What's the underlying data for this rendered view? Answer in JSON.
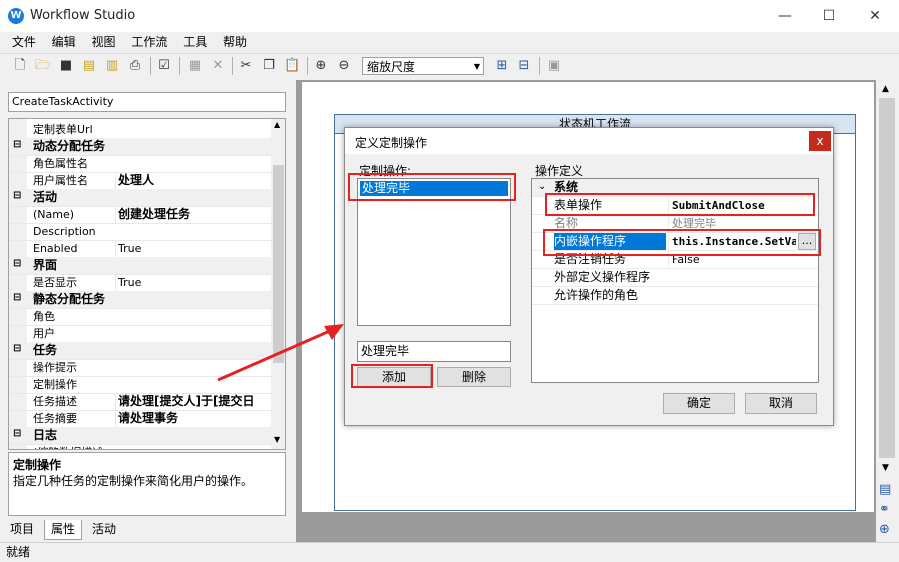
{
  "window": {
    "title": "Workflow Studio",
    "minimize": "—",
    "maximize": "☐",
    "close": "✕"
  },
  "menu": [
    "文件",
    "编辑",
    "视图",
    "工作流",
    "工具",
    "帮助"
  ],
  "toolbar": {
    "zoom_label": "缩放尺度"
  },
  "left_panel": {
    "activity": "CreateTaskActivity",
    "properties": [
      {
        "kind": "prop",
        "name": "定制表单Url",
        "value": ""
      },
      {
        "kind": "cat",
        "name": "动态分配任务"
      },
      {
        "kind": "prop",
        "name": "角色属性名",
        "value": ""
      },
      {
        "kind": "prop",
        "name": "用户属性名",
        "value": "处理人",
        "bold": true
      },
      {
        "kind": "cat",
        "name": "活动"
      },
      {
        "kind": "prop",
        "name": "(Name)",
        "value": "创建处理任务",
        "bold": true
      },
      {
        "kind": "prop",
        "name": "Description",
        "value": ""
      },
      {
        "kind": "prop",
        "name": "Enabled",
        "value": "True"
      },
      {
        "kind": "cat",
        "name": "界面"
      },
      {
        "kind": "prop",
        "name": "是否显示",
        "value": "True"
      },
      {
        "kind": "cat",
        "name": "静态分配任务"
      },
      {
        "kind": "prop",
        "name": "角色",
        "value": ""
      },
      {
        "kind": "prop",
        "name": "用户",
        "value": ""
      },
      {
        "kind": "cat",
        "name": "任务"
      },
      {
        "kind": "prop",
        "name": "操作提示",
        "value": ""
      },
      {
        "kind": "prop",
        "name": "定制操作",
        "value": ""
      },
      {
        "kind": "prop",
        "name": "任务描述",
        "value": "请处理[提交人]于[提交日",
        "bold": true
      },
      {
        "kind": "prop",
        "name": "任务摘要",
        "value": "请处理事务",
        "bold": true
      },
      {
        "kind": "cat",
        "name": "日志"
      },
      {
        "kind": "prop",
        "name": "(缩略数据描述",
        "value": ""
      }
    ],
    "description_title": "定制操作",
    "description_text": "指定几种任务的定制操作来简化用户的操作。",
    "tabs": [
      "项目",
      "属性",
      "活动"
    ]
  },
  "canvas": {
    "workflow_title": "状态机工作流"
  },
  "status": "就绪",
  "dialog": {
    "title": "定义定制操作",
    "close": "x",
    "ops_label": "定制操作:",
    "ops_items": [
      "处理完毕"
    ],
    "op_name_value": "处理完毕",
    "add_button": "添加",
    "delete_button": "删除",
    "def_label": "操作定义",
    "def_category": "系统",
    "def_rows": [
      {
        "name": "表单操作",
        "value": "SubmitAndClose"
      },
      {
        "name": "名称",
        "value": "处理完毕"
      },
      {
        "name": "内嵌操作程序",
        "value": "this.Instance.SetVa"
      },
      {
        "name": "是否注销任务",
        "value": "False"
      },
      {
        "name": "外部定义操作程序",
        "value": ""
      },
      {
        "name": "允许操作的角色",
        "value": ""
      }
    ],
    "ellipsis": "...",
    "ok_button": "确定",
    "cancel_button": "取消"
  },
  "colors": {
    "highlight": "#e52222",
    "selection": "#0078d7",
    "arrow": "#e52222"
  }
}
